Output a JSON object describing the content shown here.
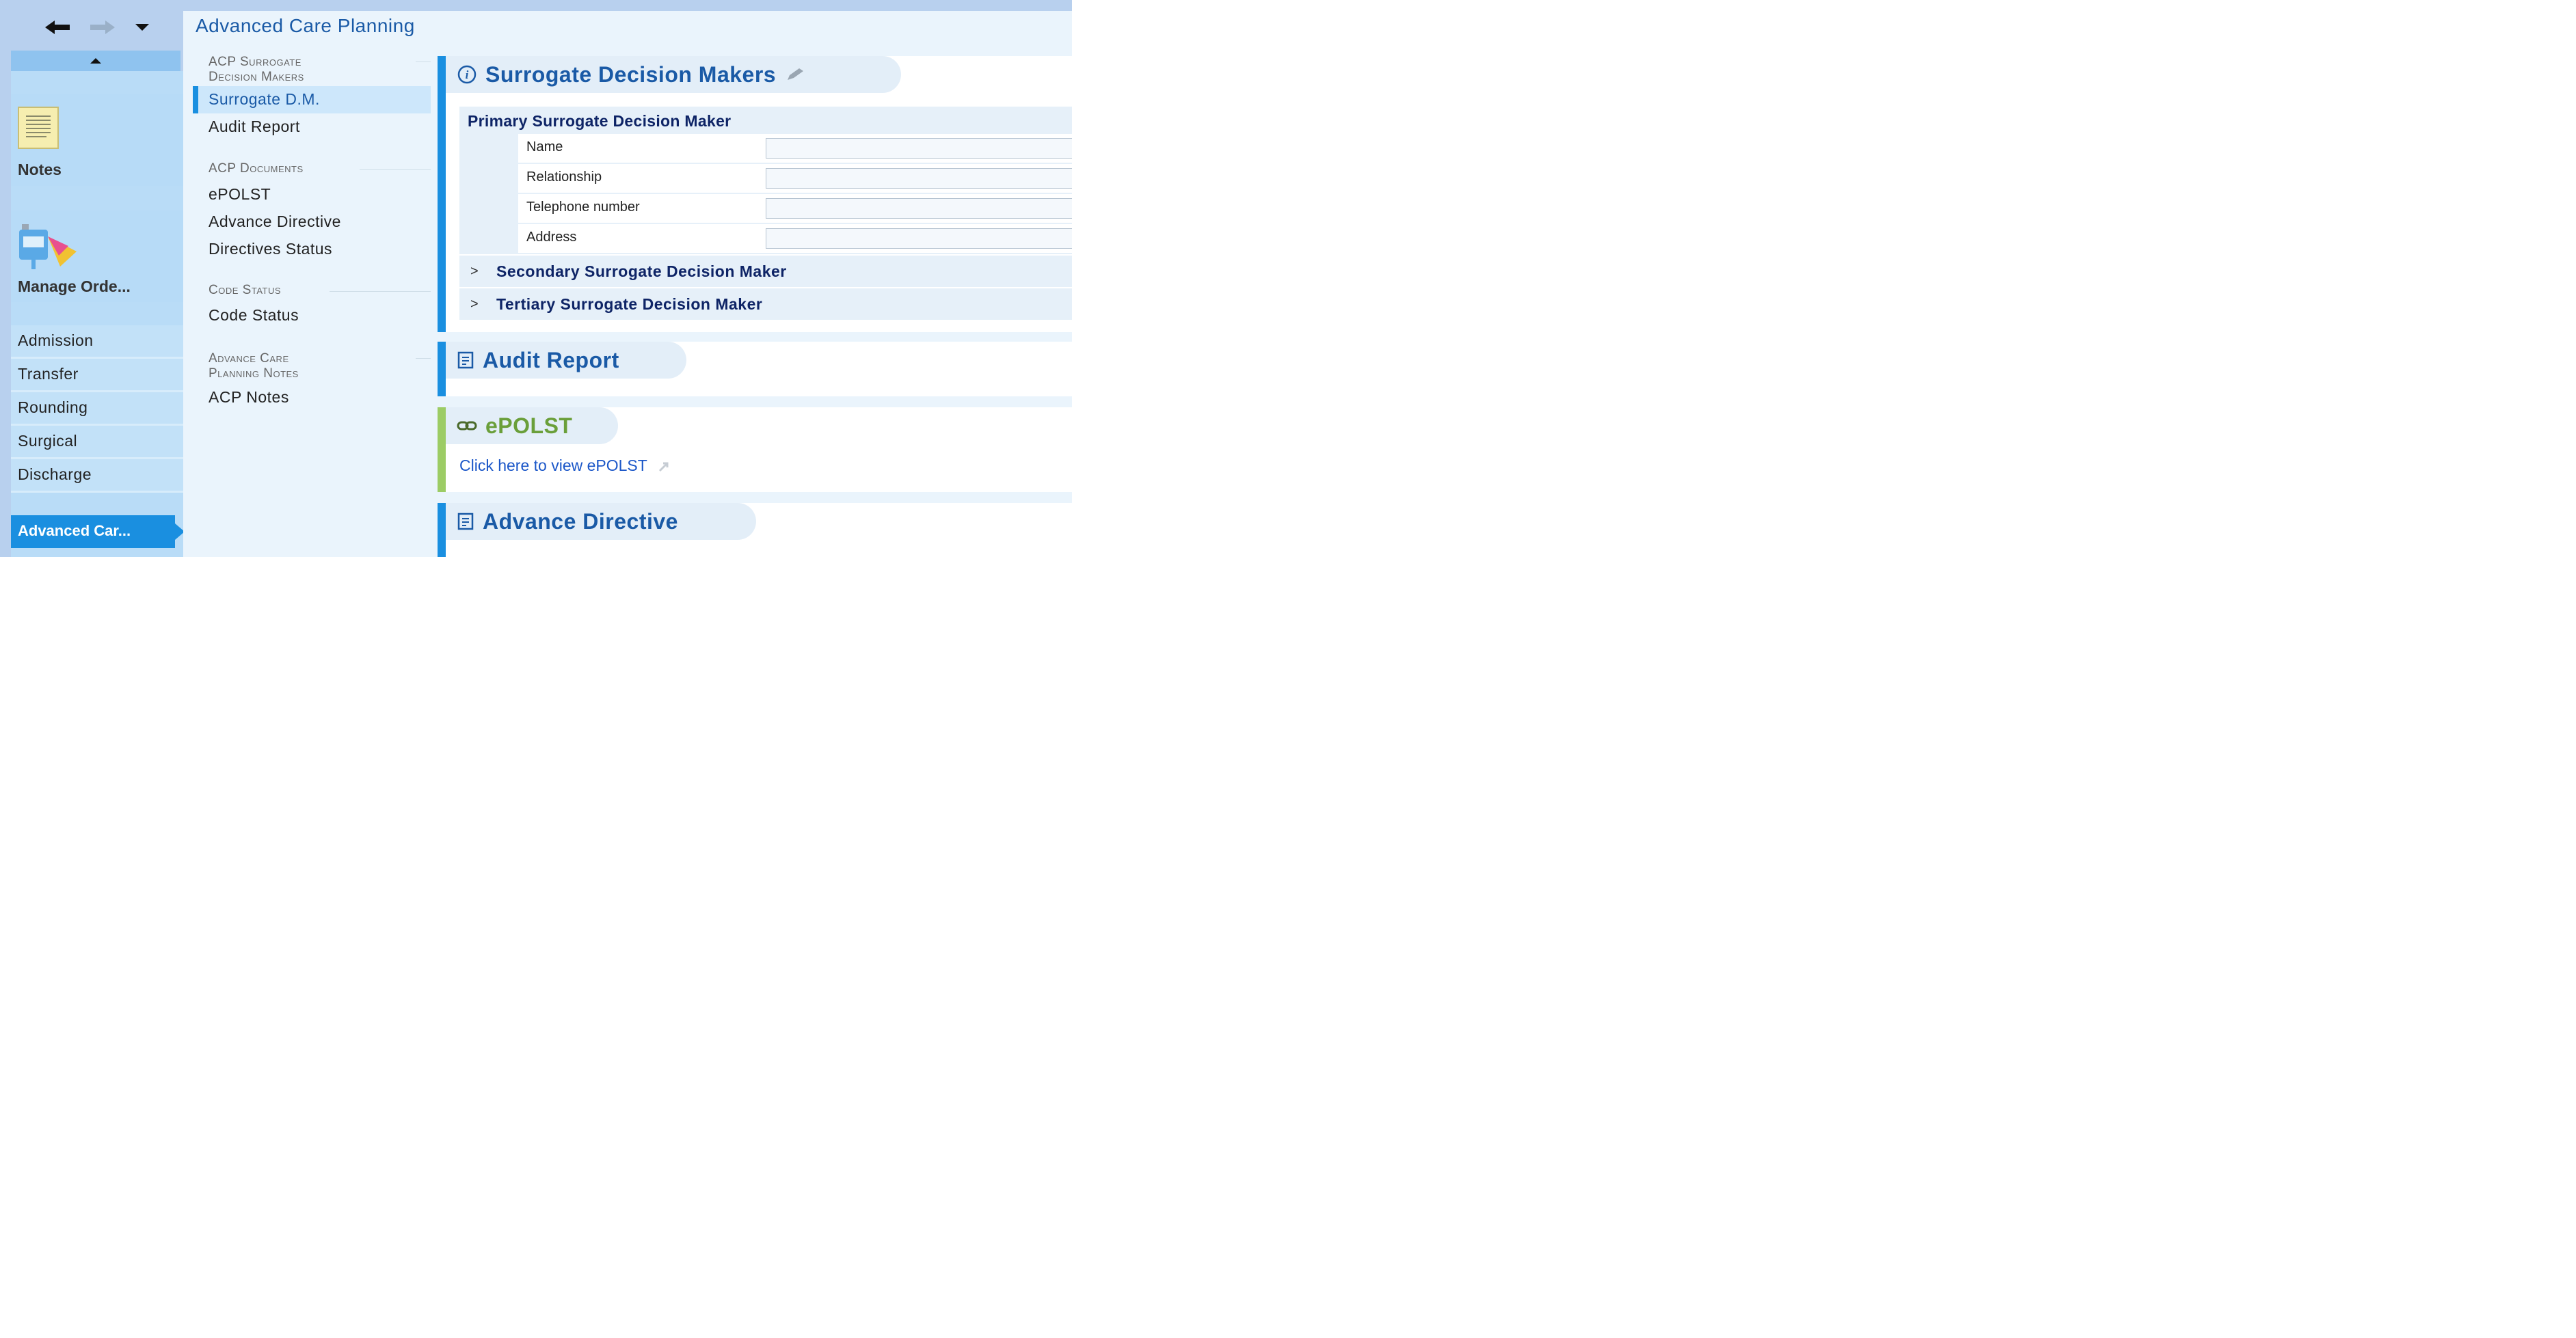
{
  "leftnav": {
    "notes_label": "Notes",
    "orders_label": "Manage Orde...",
    "items": [
      "Admission",
      "Transfer",
      "Rounding",
      "Surgical",
      "Discharge"
    ],
    "active_label": "Advanced Car..."
  },
  "main": {
    "title": "Advanced Care Planning"
  },
  "sectionnav": {
    "group1_line1": "ACP Surrogate",
    "group1_line2": "Decision Makers",
    "surrogate_link": "Surrogate D.M.",
    "audit_link": "Audit Report",
    "group2": "ACP Documents",
    "epolst_link": "ePOLST",
    "advance_directive_link": "Advance Directive",
    "directives_status_link": "Directives Status",
    "group3": "Code Status",
    "code_status_link": "Code Status",
    "group4_line1": "Advance Care",
    "group4_line2": "Planning Notes",
    "acp_notes_link": "ACP Notes"
  },
  "surrogate": {
    "title": "Surrogate Decision Makers",
    "primary_title": "Primary Surrogate Decision Maker",
    "fields": [
      {
        "label": "Name",
        "value": ""
      },
      {
        "label": "Relationship",
        "value": ""
      },
      {
        "label": "Telephone number",
        "value": ""
      },
      {
        "label": "Address",
        "value": ""
      }
    ],
    "secondary_title": "Secondary Surrogate Decision Maker",
    "tertiary_title": "Tertiary Surrogate Decision Maker"
  },
  "audit": {
    "title": "Audit Report"
  },
  "epolst": {
    "title": "ePOLST",
    "link": "Click here to view ePOLST"
  },
  "advance_directive": {
    "title": "Advance Directive"
  },
  "colors": {
    "accent": "#1a8fe0",
    "heading": "#1a5aa6",
    "epolst_green": "#9ccc65"
  }
}
